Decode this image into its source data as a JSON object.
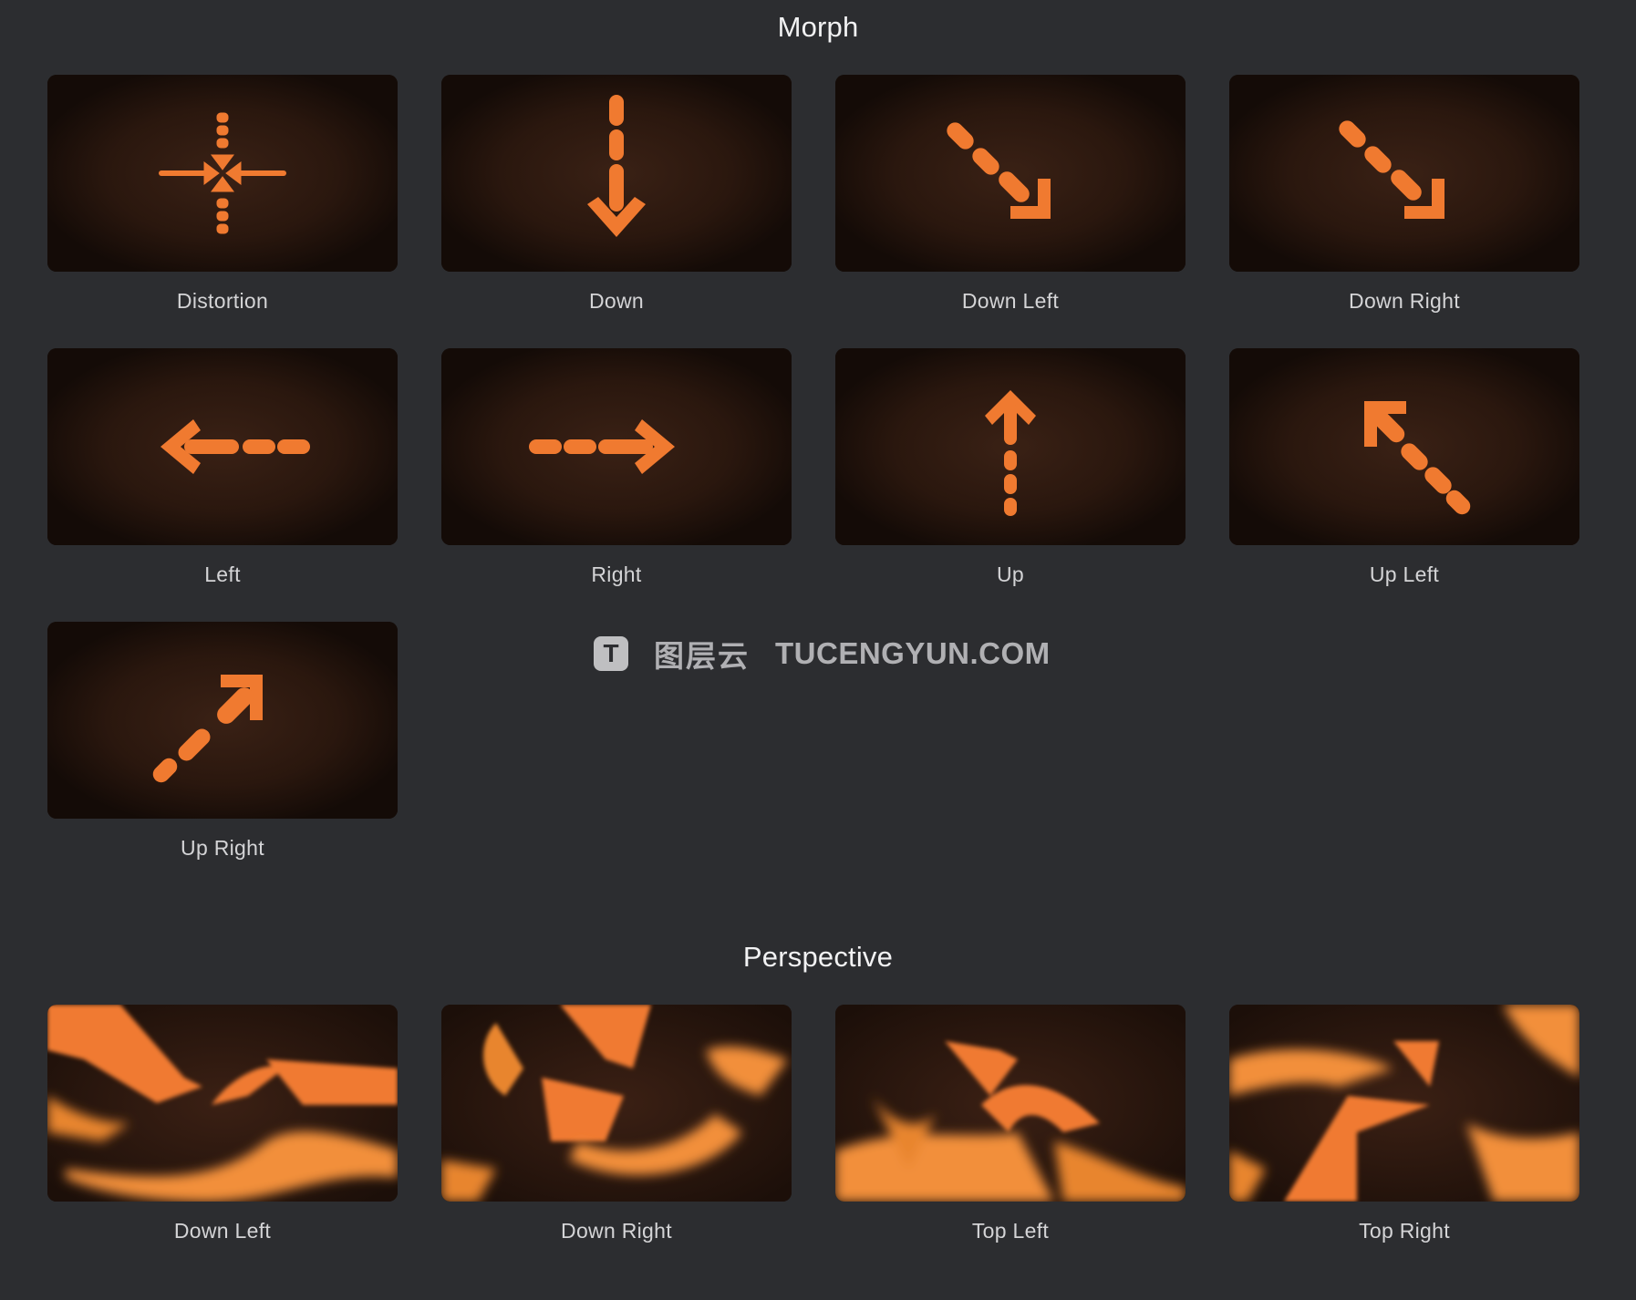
{
  "sections": {
    "morph": {
      "title": "Morph",
      "items": [
        {
          "label": "Distortion",
          "icon": "crosshair-arrows-icon"
        },
        {
          "label": "Down",
          "icon": "arrow-down-icon"
        },
        {
          "label": "Down Left",
          "icon": "arrow-down-right-icon"
        },
        {
          "label": "Down Right",
          "icon": "arrow-down-right-icon"
        },
        {
          "label": "Left",
          "icon": "arrow-left-icon"
        },
        {
          "label": "Right",
          "icon": "arrow-right-icon"
        },
        {
          "label": "Up",
          "icon": "arrow-up-icon"
        },
        {
          "label": "Up Left",
          "icon": "arrow-up-left-icon"
        },
        {
          "label": "Up Right",
          "icon": "arrow-up-right-icon"
        }
      ]
    },
    "perspective": {
      "title": "Perspective",
      "items": [
        {
          "label": "Down Left"
        },
        {
          "label": "Down Right"
        },
        {
          "label": "Top Left"
        },
        {
          "label": "Top Right"
        }
      ]
    }
  },
  "watermark": {
    "logo_letter": "T",
    "cn_text": "图层云",
    "en_text": "TUCENGYUN.COM"
  },
  "colors": {
    "background": "#2c2d30",
    "accent_orange": "#f07a30",
    "thumb_dark": "#1a0f0a"
  }
}
